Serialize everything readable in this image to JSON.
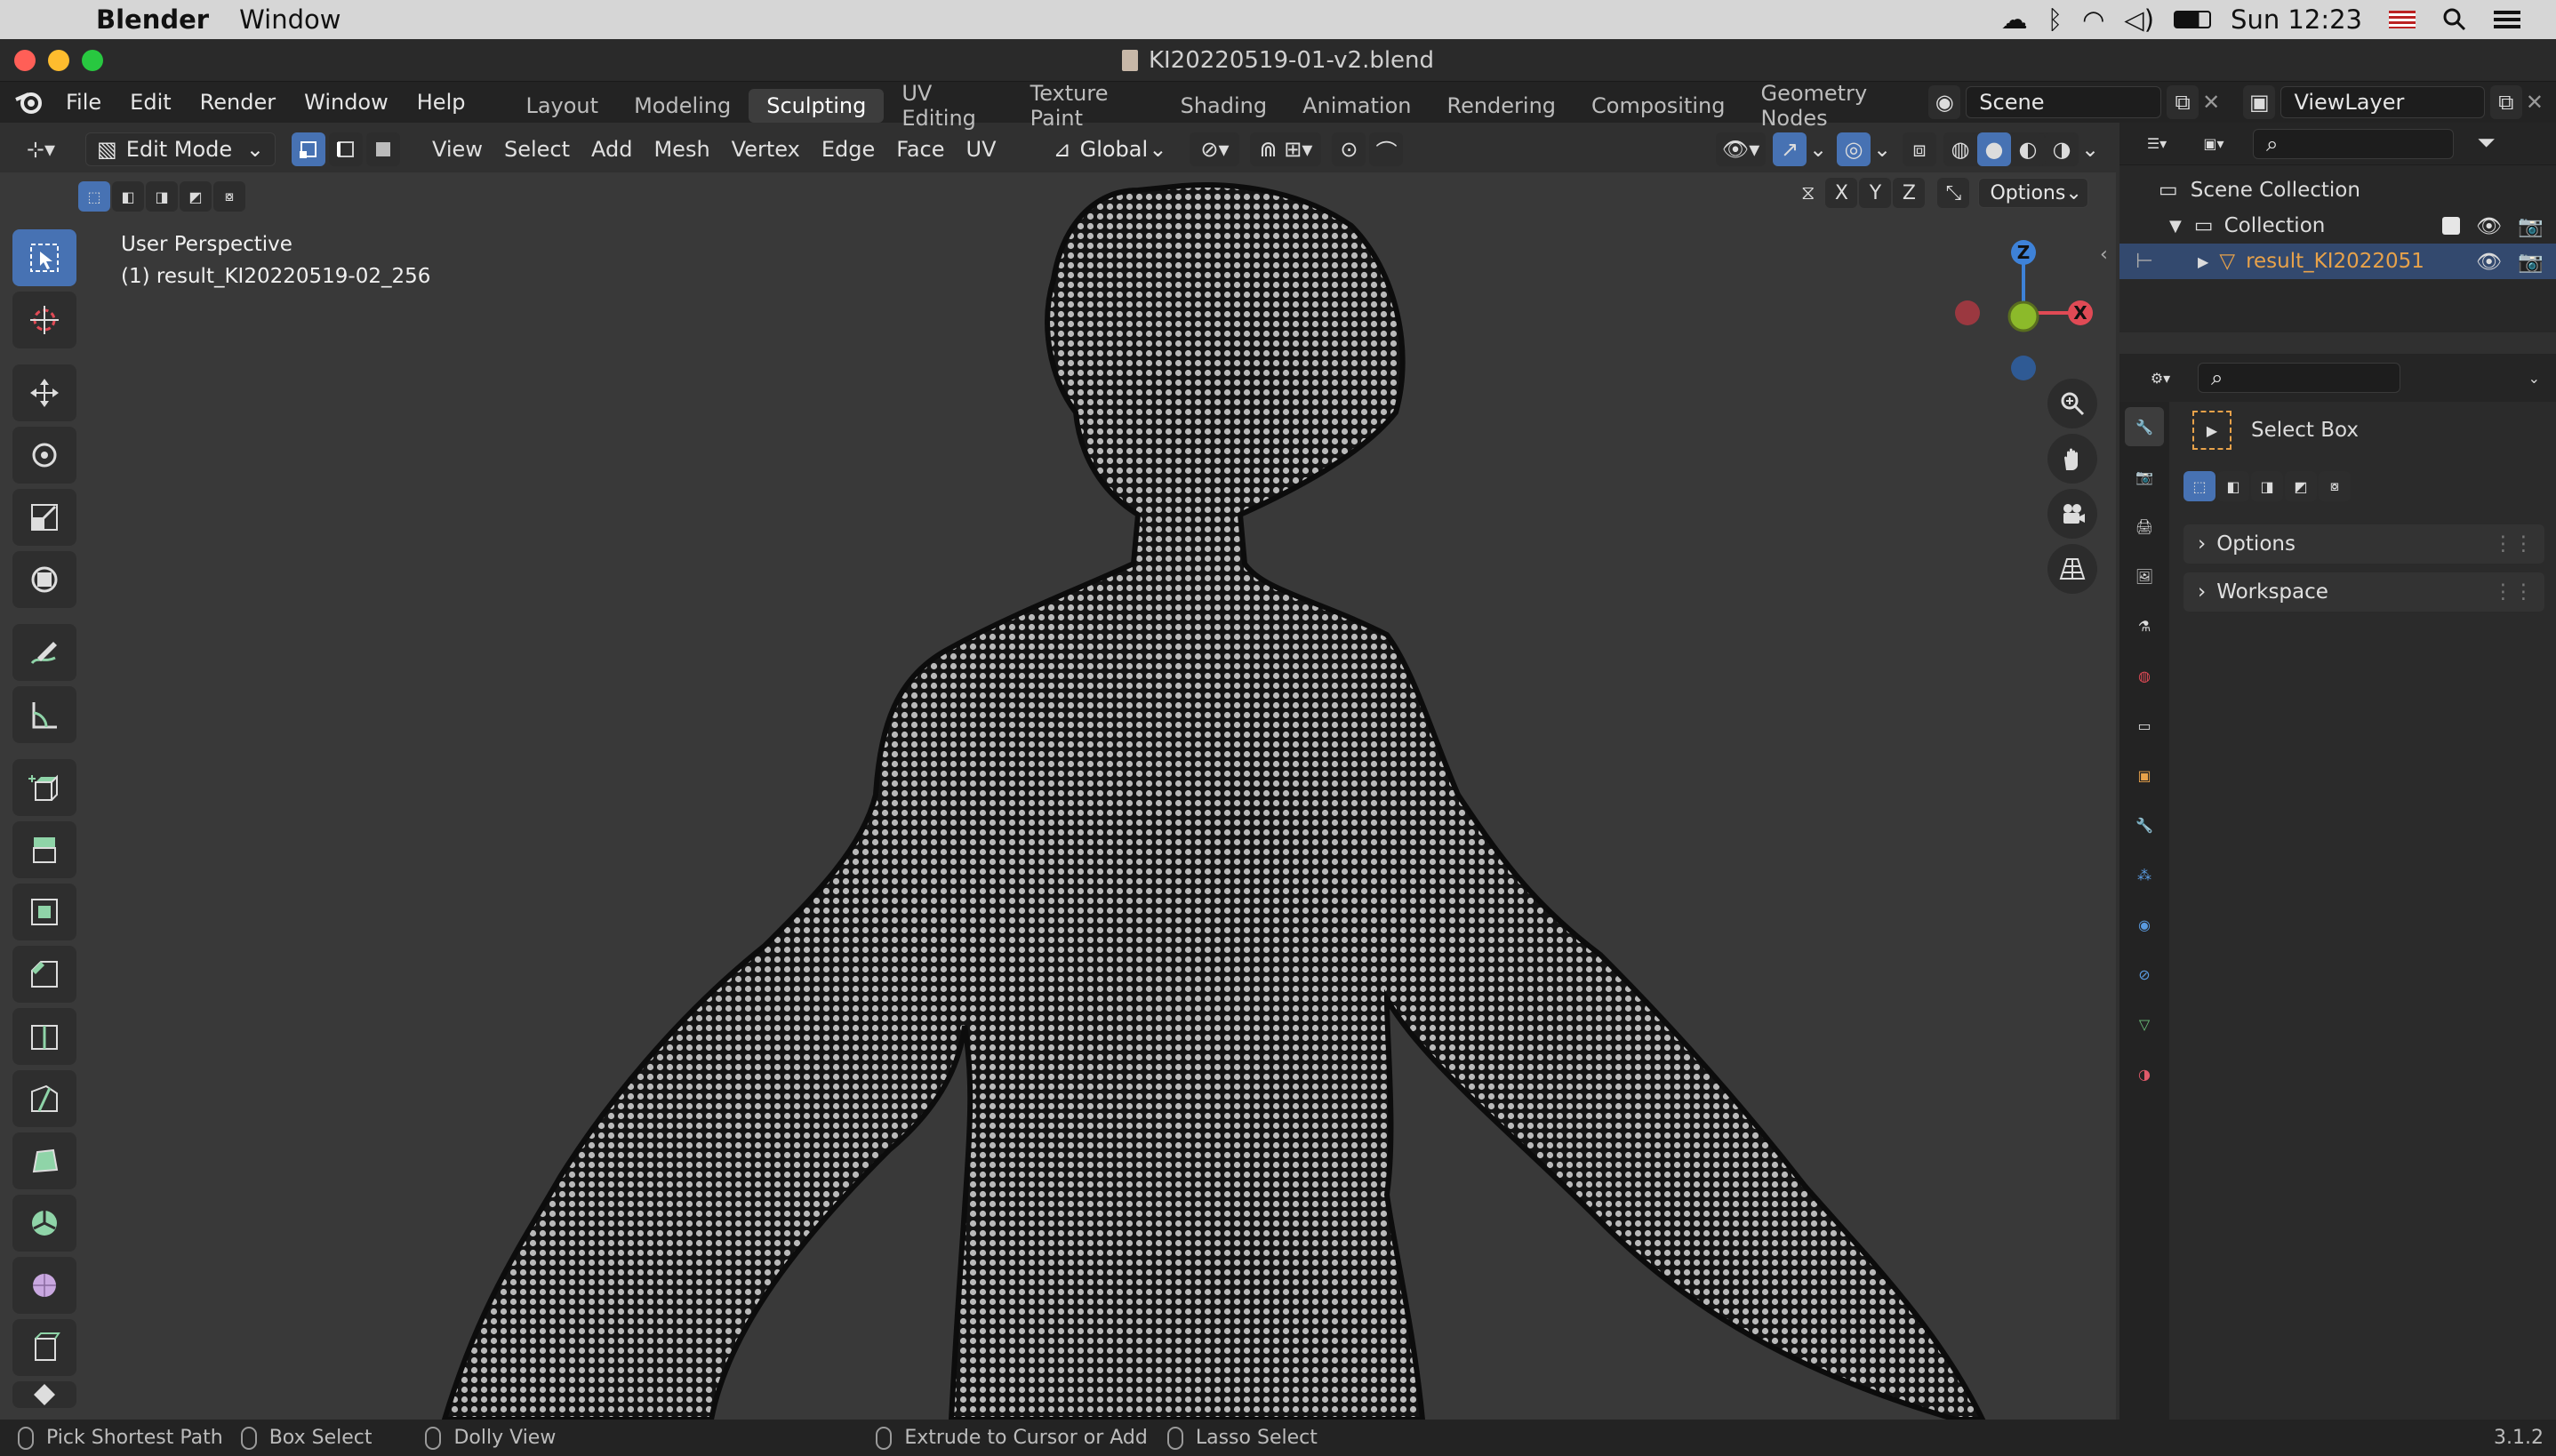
{
  "macbar": {
    "app": "Blender",
    "menu_window": "Window",
    "clock": "Sun 12:23"
  },
  "window": {
    "title": "KI20220519-01-v2.blend"
  },
  "topbar": {
    "menus": [
      "File",
      "Edit",
      "Render",
      "Window",
      "Help"
    ],
    "workspaces": [
      "Layout",
      "Modeling",
      "Sculpting",
      "UV Editing",
      "Texture Paint",
      "Shading",
      "Animation",
      "Rendering",
      "Compositing",
      "Geometry Nodes"
    ],
    "active_workspace": "Sculpting",
    "scene": "Scene",
    "view_layer": "ViewLayer"
  },
  "viewport_header": {
    "mode": "Edit Mode",
    "menus": [
      "View",
      "Select",
      "Add",
      "Mesh",
      "Vertex",
      "Edge",
      "Face",
      "UV"
    ],
    "transform_orientation": "Global",
    "axes": [
      "X",
      "Y",
      "Z"
    ],
    "options_label": "Options"
  },
  "viewport": {
    "perspective": "User Perspective",
    "object_info": "(1) result_KI20220519-02_256",
    "gizmo": {
      "z": "Z",
      "y": "Y",
      "x": "X"
    }
  },
  "outliner": {
    "scene_collection": "Scene Collection",
    "collection": "Collection",
    "object": "result_KI2022051"
  },
  "properties": {
    "active_tool": "Select Box",
    "panels": [
      "Options",
      "Workspace"
    ]
  },
  "statusbar": {
    "items": [
      "Pick Shortest Path",
      "Box Select",
      "Dolly View",
      "Extrude to Cursor or Add",
      "Lasso Select"
    ],
    "version": "3.1.2"
  },
  "colors": {
    "accent": "#4772b3",
    "object_orange": "#e8a24a",
    "axis_x": "#e04a55",
    "axis_y": "#8cba2a",
    "axis_z": "#3e82d8"
  }
}
